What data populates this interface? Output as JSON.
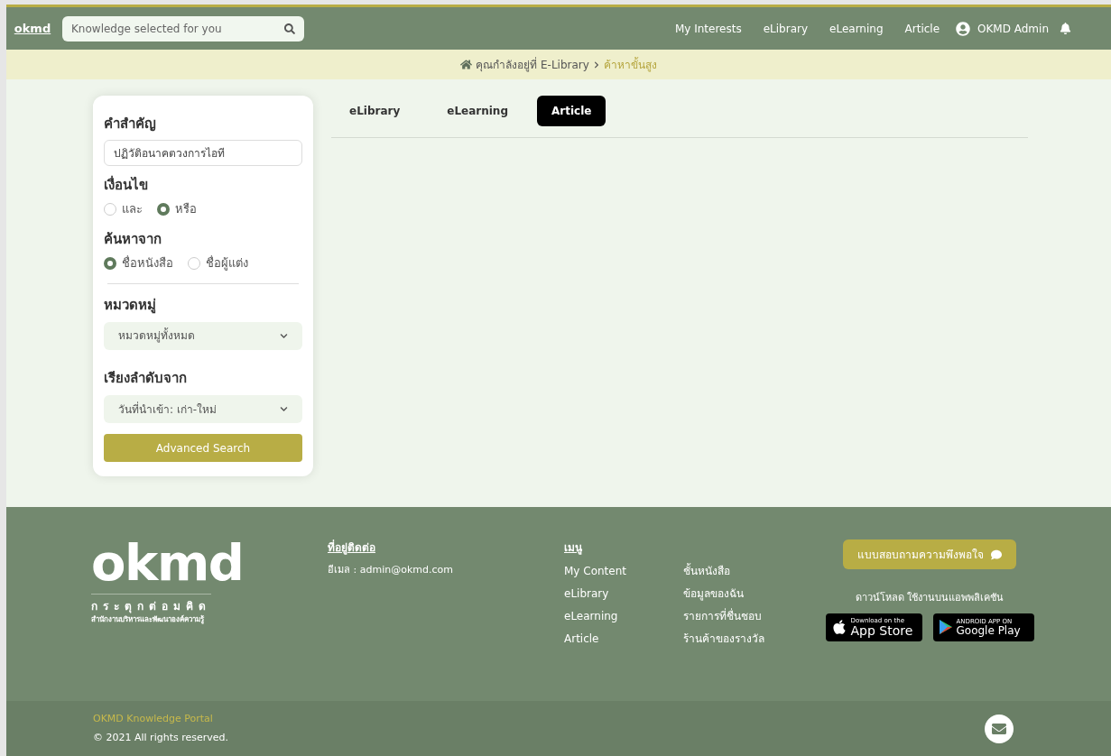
{
  "header": {
    "logo": "okmd",
    "search": {
      "placeholder": "Knowledge selected for you"
    },
    "nav": [
      "My Interests",
      "eLibrary",
      "eLearning",
      "Article"
    ],
    "user": "OKMD Admin"
  },
  "breadcrumb": {
    "items": [
      "คุณกำลังอยู่ที่ E-Library",
      "ค้าหาขั้นสูง"
    ]
  },
  "filters": {
    "keyword": {
      "label": "คำสำคัญ",
      "value": "ปฏิวัติอนาคตวงการไอที"
    },
    "condition": {
      "label": "เงื่อนไข",
      "options": [
        {
          "label": "และ",
          "selected": false
        },
        {
          "label": "หรือ",
          "selected": true
        }
      ]
    },
    "search_by": {
      "label": "ค้นหาจาก",
      "options": [
        {
          "label": "ชื่อหนังสือ",
          "selected": true
        },
        {
          "label": "ชื่อผู้แต่ง",
          "selected": false
        }
      ]
    },
    "category": {
      "label": "หมวดหมู่",
      "value": "หมวดหมู่ทั้งหมด"
    },
    "sort": {
      "label": "เรียงลำดับจาก",
      "value": "วันที่นำเข้า: เก่า-ใหม่"
    },
    "button": "Advanced Search"
  },
  "tabs": [
    {
      "label": "eLibrary",
      "selected": false
    },
    {
      "label": "eLearning",
      "selected": false
    },
    {
      "label": "Article",
      "selected": true
    }
  ],
  "footer": {
    "logo": {
      "word": "okmd",
      "tagline": "กระตุกต่อมคิด",
      "org": "สำนักงานบริหารและพัฒนาองค์ความรู้"
    },
    "contact": {
      "title": "ที่อยู่ติดต่อ",
      "email": "อีเมล : admin@okmd.com"
    },
    "menu": {
      "title": "เมนู",
      "column_1": [
        "My Content",
        "eLibrary",
        "eLearning",
        "Article"
      ],
      "column_2": [
        "ชั้นหนังสือ",
        "ข้อมูลของฉัน",
        "รายการที่ชื่นชอบ",
        "ร้านค้าของรางวัล"
      ]
    },
    "survey_button": "แบบสอบถามความพึงพอใจ",
    "download_text": "ดาวน์โหลด ใช้งานบนแอพพลิเคชัน",
    "app_store": {
      "small": "Download on the",
      "big": "App Store"
    },
    "google_play": {
      "small": "ANDROID APP ON",
      "big": "Google Play"
    }
  },
  "bottom": {
    "portal": "OKMD Knowledge Portal",
    "copyright": "© 2021 All rights reserved."
  }
}
